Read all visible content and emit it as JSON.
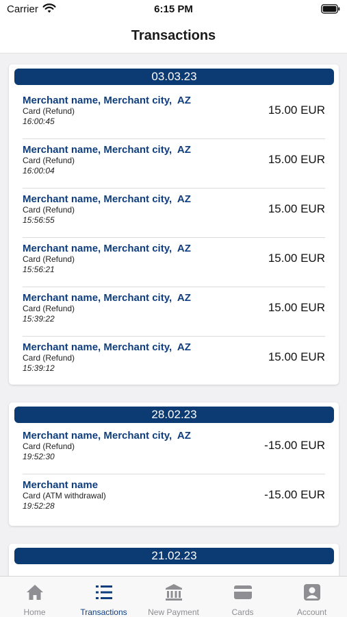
{
  "status_bar": {
    "carrier": "Carrier",
    "time": "6:15 PM"
  },
  "header": {
    "title": "Transactions"
  },
  "groups": [
    {
      "date": "03.03.23",
      "transactions": [
        {
          "merchant": "Merchant name, Merchant city,  AZ",
          "type": "Card (Refund)",
          "time": "16:00:45",
          "amount": "15.00 EUR"
        },
        {
          "merchant": "Merchant name, Merchant city,  AZ",
          "type": "Card (Refund)",
          "time": "16:00:04",
          "amount": "15.00 EUR"
        },
        {
          "merchant": "Merchant name, Merchant city,  AZ",
          "type": "Card (Refund)",
          "time": "15:56:55",
          "amount": "15.00 EUR"
        },
        {
          "merchant": "Merchant name, Merchant city,  AZ",
          "type": "Card (Refund)",
          "time": "15:56:21",
          "amount": "15.00 EUR"
        },
        {
          "merchant": "Merchant name, Merchant city,  AZ",
          "type": "Card (Refund)",
          "time": "15:39:22",
          "amount": "15.00 EUR"
        },
        {
          "merchant": "Merchant name, Merchant city,  AZ",
          "type": "Card (Refund)",
          "time": "15:39:12",
          "amount": "15.00 EUR"
        }
      ]
    },
    {
      "date": "28.02.23",
      "transactions": [
        {
          "merchant": "Merchant name, Merchant city,  AZ",
          "type": "Card (Refund)",
          "time": "19:52:30",
          "amount": "-15.00 EUR"
        },
        {
          "merchant": "Merchant name",
          "type": "Card (ATM withdrawal)",
          "time": "19:52:28",
          "amount": "-15.00 EUR"
        }
      ]
    },
    {
      "date": "21.02.23",
      "transactions": []
    }
  ],
  "tab_bar": {
    "tabs": [
      {
        "label": "Home",
        "icon": "home-icon",
        "active": false
      },
      {
        "label": "Transactions",
        "icon": "list-icon",
        "active": true
      },
      {
        "label": "New Payment",
        "icon": "bank-icon",
        "active": false
      },
      {
        "label": "Cards",
        "icon": "card-icon",
        "active": false
      },
      {
        "label": "Account",
        "icon": "account-icon",
        "active": false
      }
    ]
  },
  "colors": {
    "brand": "#0c3b74",
    "merchant_text": "#0e3e7e",
    "tab_active": "#0e3e7e",
    "tab_inactive": "#8e8e93",
    "background": "#f1f1f3"
  }
}
